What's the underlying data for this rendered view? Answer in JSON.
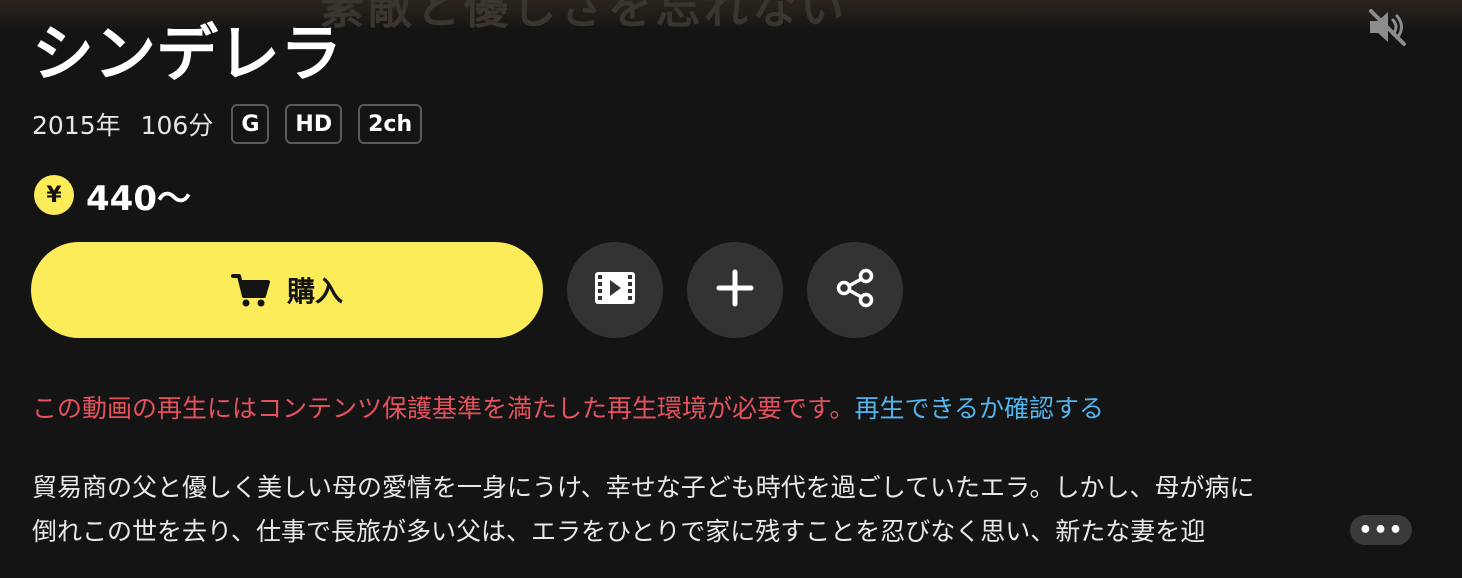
{
  "hero": {
    "background_text": "素敵と優しさを忘れない"
  },
  "mute_button": {
    "icon": "volume-muted-icon"
  },
  "title": "シンデレラ",
  "meta": {
    "year": "2015年",
    "duration": "106分",
    "badges": [
      "G",
      "HD",
      "2ch"
    ]
  },
  "price": {
    "currency_symbol": "¥",
    "amount": "440〜"
  },
  "actions": {
    "buy_label": "購入",
    "buy_icon": "cart-icon",
    "trailer_icon": "film-icon",
    "add_icon": "plus-icon",
    "share_icon": "share-icon"
  },
  "notice": {
    "warning_text": "この動画の再生にはコンテンツ保護基準を満たした再生環境が必要です。",
    "link_text": "再生できるか確認する"
  },
  "synopsis": {
    "line1": "貿易商の父と優しく美しい母の愛情を一身にうけ、幸せな子ども時代を過ごしていたエラ。しかし、母が病に",
    "line2": "倒れこの世を去り、仕事で長旅が多い父は、エラをひとりで家に残すことを忍びなく思い、新たな妻を迎",
    "more_label": "•••"
  },
  "colors": {
    "background": "#141414",
    "accent_yellow": "#fcec5a",
    "warning_red": "#e4525e",
    "link_blue": "#54b4ec",
    "button_gray": "#333333"
  }
}
